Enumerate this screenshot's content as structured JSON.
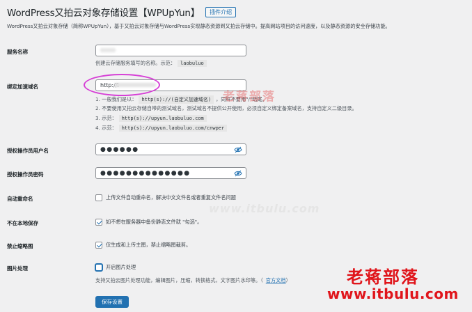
{
  "header": {
    "title": "WordPress又拍云对象存储设置【WPUpYun】",
    "intro_button": "插件介绍",
    "description": "WordPress又拍云对象存储（简称WPUpYun），基于又拍云对象存储与WordPress实现静态资源到又拍云存储中。提高网站项目的访问速度，以及静态资源的安全存储功能。"
  },
  "service_name": {
    "label": "服务名称",
    "value": "",
    "hint_text": "创建云存储服务填写的名称。示范：",
    "hint_code": "laobuluo"
  },
  "domain": {
    "label": "绑定加速域名",
    "value": "http://i",
    "hint1_pre": "1. 一般我们是以：",
    "hint1_code": "http(s)://(自定义加速域名)",
    "hint1_post": "，同样不要用\"/\"结尾。",
    "hint2": "2. 不要使用又拍云存储自带的测试域名，测试域名不提供公开使用，必须自定义绑定备案域名，支持自定义二级目录。",
    "hint3_pre": "3. 示范：",
    "hint3_code": "http(s)://upyun.laobuluo.com",
    "hint4_pre": "4. 示范：",
    "hint4_code": "http(s)://upyun.laobuluo.com/cnwper"
  },
  "operator_user": {
    "label": "授权操作员用户名",
    "masked_value": "●●●●●●",
    "icon": "eye-slash-icon"
  },
  "operator_password": {
    "label": "授权操作员密码",
    "masked_value": "●●●●●●●●●●●●●●",
    "icon": "eye-slash-icon"
  },
  "auto_rename": {
    "label": "自动重命名",
    "checked": false,
    "text": "上传文件自动重命名，解决中文文件名或者重复文件名问题"
  },
  "no_local_save": {
    "label": "不在本地保存",
    "checked": true,
    "text": "如不想在服务器中备份静态文件就 \"勾选\"。"
  },
  "disable_thumbnails": {
    "label": "禁止缩略图",
    "checked": true,
    "text": "仅生成和上传主图，禁止缩略图裁剪。"
  },
  "image_processing": {
    "label": "图片处理",
    "checked": false,
    "text": "开启图片处理",
    "desc": "支持又拍云图片处理功能，编辑图片，压缩，转换格式，文字图片水印等。（",
    "link_text": "官方文档",
    "desc_close": "）"
  },
  "save_button": "保存设置",
  "watermarks": {
    "small": "老蒋部落",
    "faint": "www.itbulu.com",
    "logo": "老蒋部落",
    "url": "www.itbulu.com"
  },
  "colors": {
    "accent": "#2271b1",
    "highlight": "#d63fd6",
    "watermark": "#e0151b"
  }
}
